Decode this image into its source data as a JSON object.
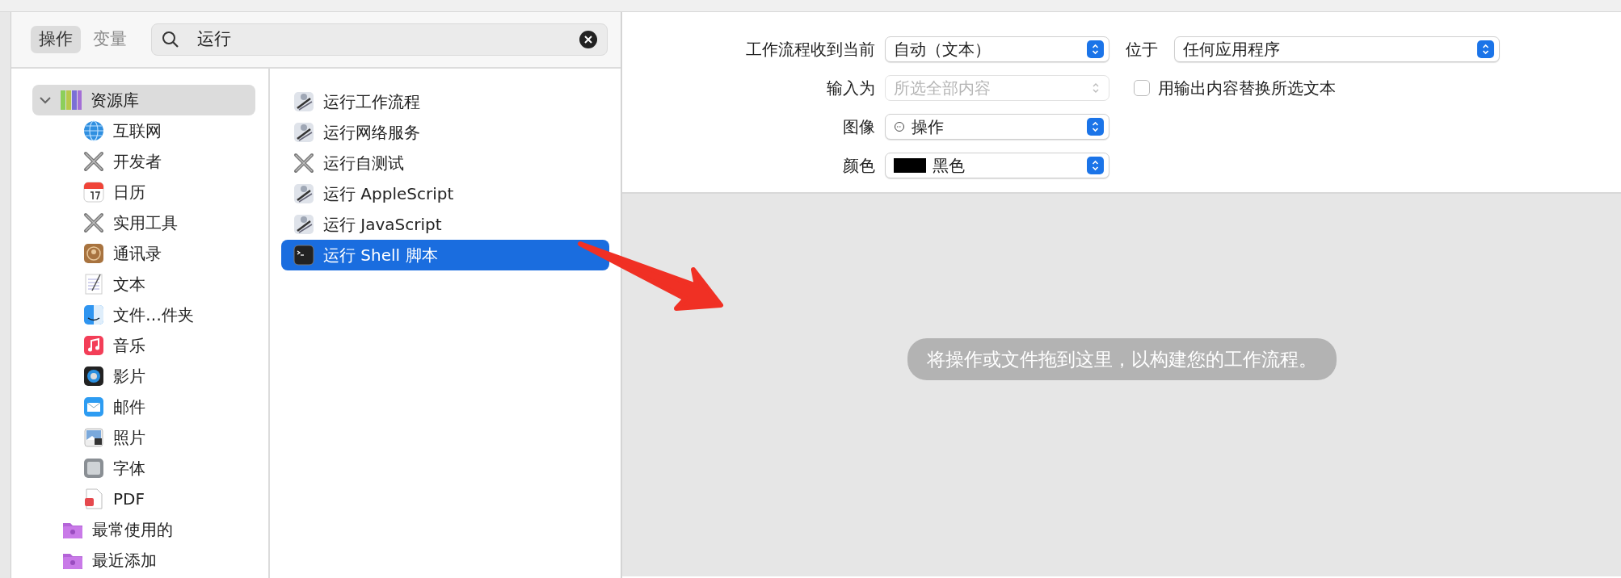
{
  "tabs": [
    {
      "label": "操作",
      "selected": true
    },
    {
      "label": "变量",
      "selected": false
    }
  ],
  "search": {
    "value": "运行"
  },
  "library": {
    "label": "资源库",
    "expanded": true,
    "selected": true,
    "children": [
      {
        "label": "互联网",
        "kind": "globe"
      },
      {
        "label": "开发者",
        "kind": "tools"
      },
      {
        "label": "日历",
        "kind": "calendar"
      },
      {
        "label": "实用工具",
        "kind": "tools"
      },
      {
        "label": "通讯录",
        "kind": "contacts"
      },
      {
        "label": "文本",
        "kind": "text"
      },
      {
        "label": "文件…件夹",
        "kind": "finder"
      },
      {
        "label": "音乐",
        "kind": "music"
      },
      {
        "label": "影片",
        "kind": "movie"
      },
      {
        "label": "邮件",
        "kind": "mail"
      },
      {
        "label": "照片",
        "kind": "photo"
      },
      {
        "label": "字体",
        "kind": "font"
      },
      {
        "label": "PDF",
        "kind": "pdf"
      }
    ]
  },
  "smart_groups": [
    {
      "label": "最常使用的"
    },
    {
      "label": "最近添加"
    }
  ],
  "actions": [
    {
      "label": "运行工作流程",
      "kind": "automator",
      "selected": false
    },
    {
      "label": "运行网络服务",
      "kind": "automator",
      "selected": false
    },
    {
      "label": "运行自测试",
      "kind": "tools",
      "selected": false
    },
    {
      "label": "运行 AppleScript",
      "kind": "automator",
      "selected": false
    },
    {
      "label": "运行 JavaScript",
      "kind": "automator",
      "selected": false
    },
    {
      "label": "运行 Shell 脚本",
      "kind": "terminal",
      "selected": true
    }
  ],
  "workflow_settings": {
    "receives": {
      "label": "工作流程收到当前",
      "value": "自动（文本）"
    },
    "in": {
      "label": "位于",
      "value": "任何应用程序"
    },
    "input": {
      "label": "输入为",
      "placeholder": "所选全部内容",
      "disabled": true
    },
    "replace": {
      "label": "用输出内容替换所选文本",
      "checked": false
    },
    "image": {
      "label": "图像",
      "value": "操作"
    },
    "color": {
      "label": "颜色",
      "value": "黑色",
      "color": "#000000"
    }
  },
  "drop_hint": "将操作或文件拖到这里，以构建您的工作流程。"
}
